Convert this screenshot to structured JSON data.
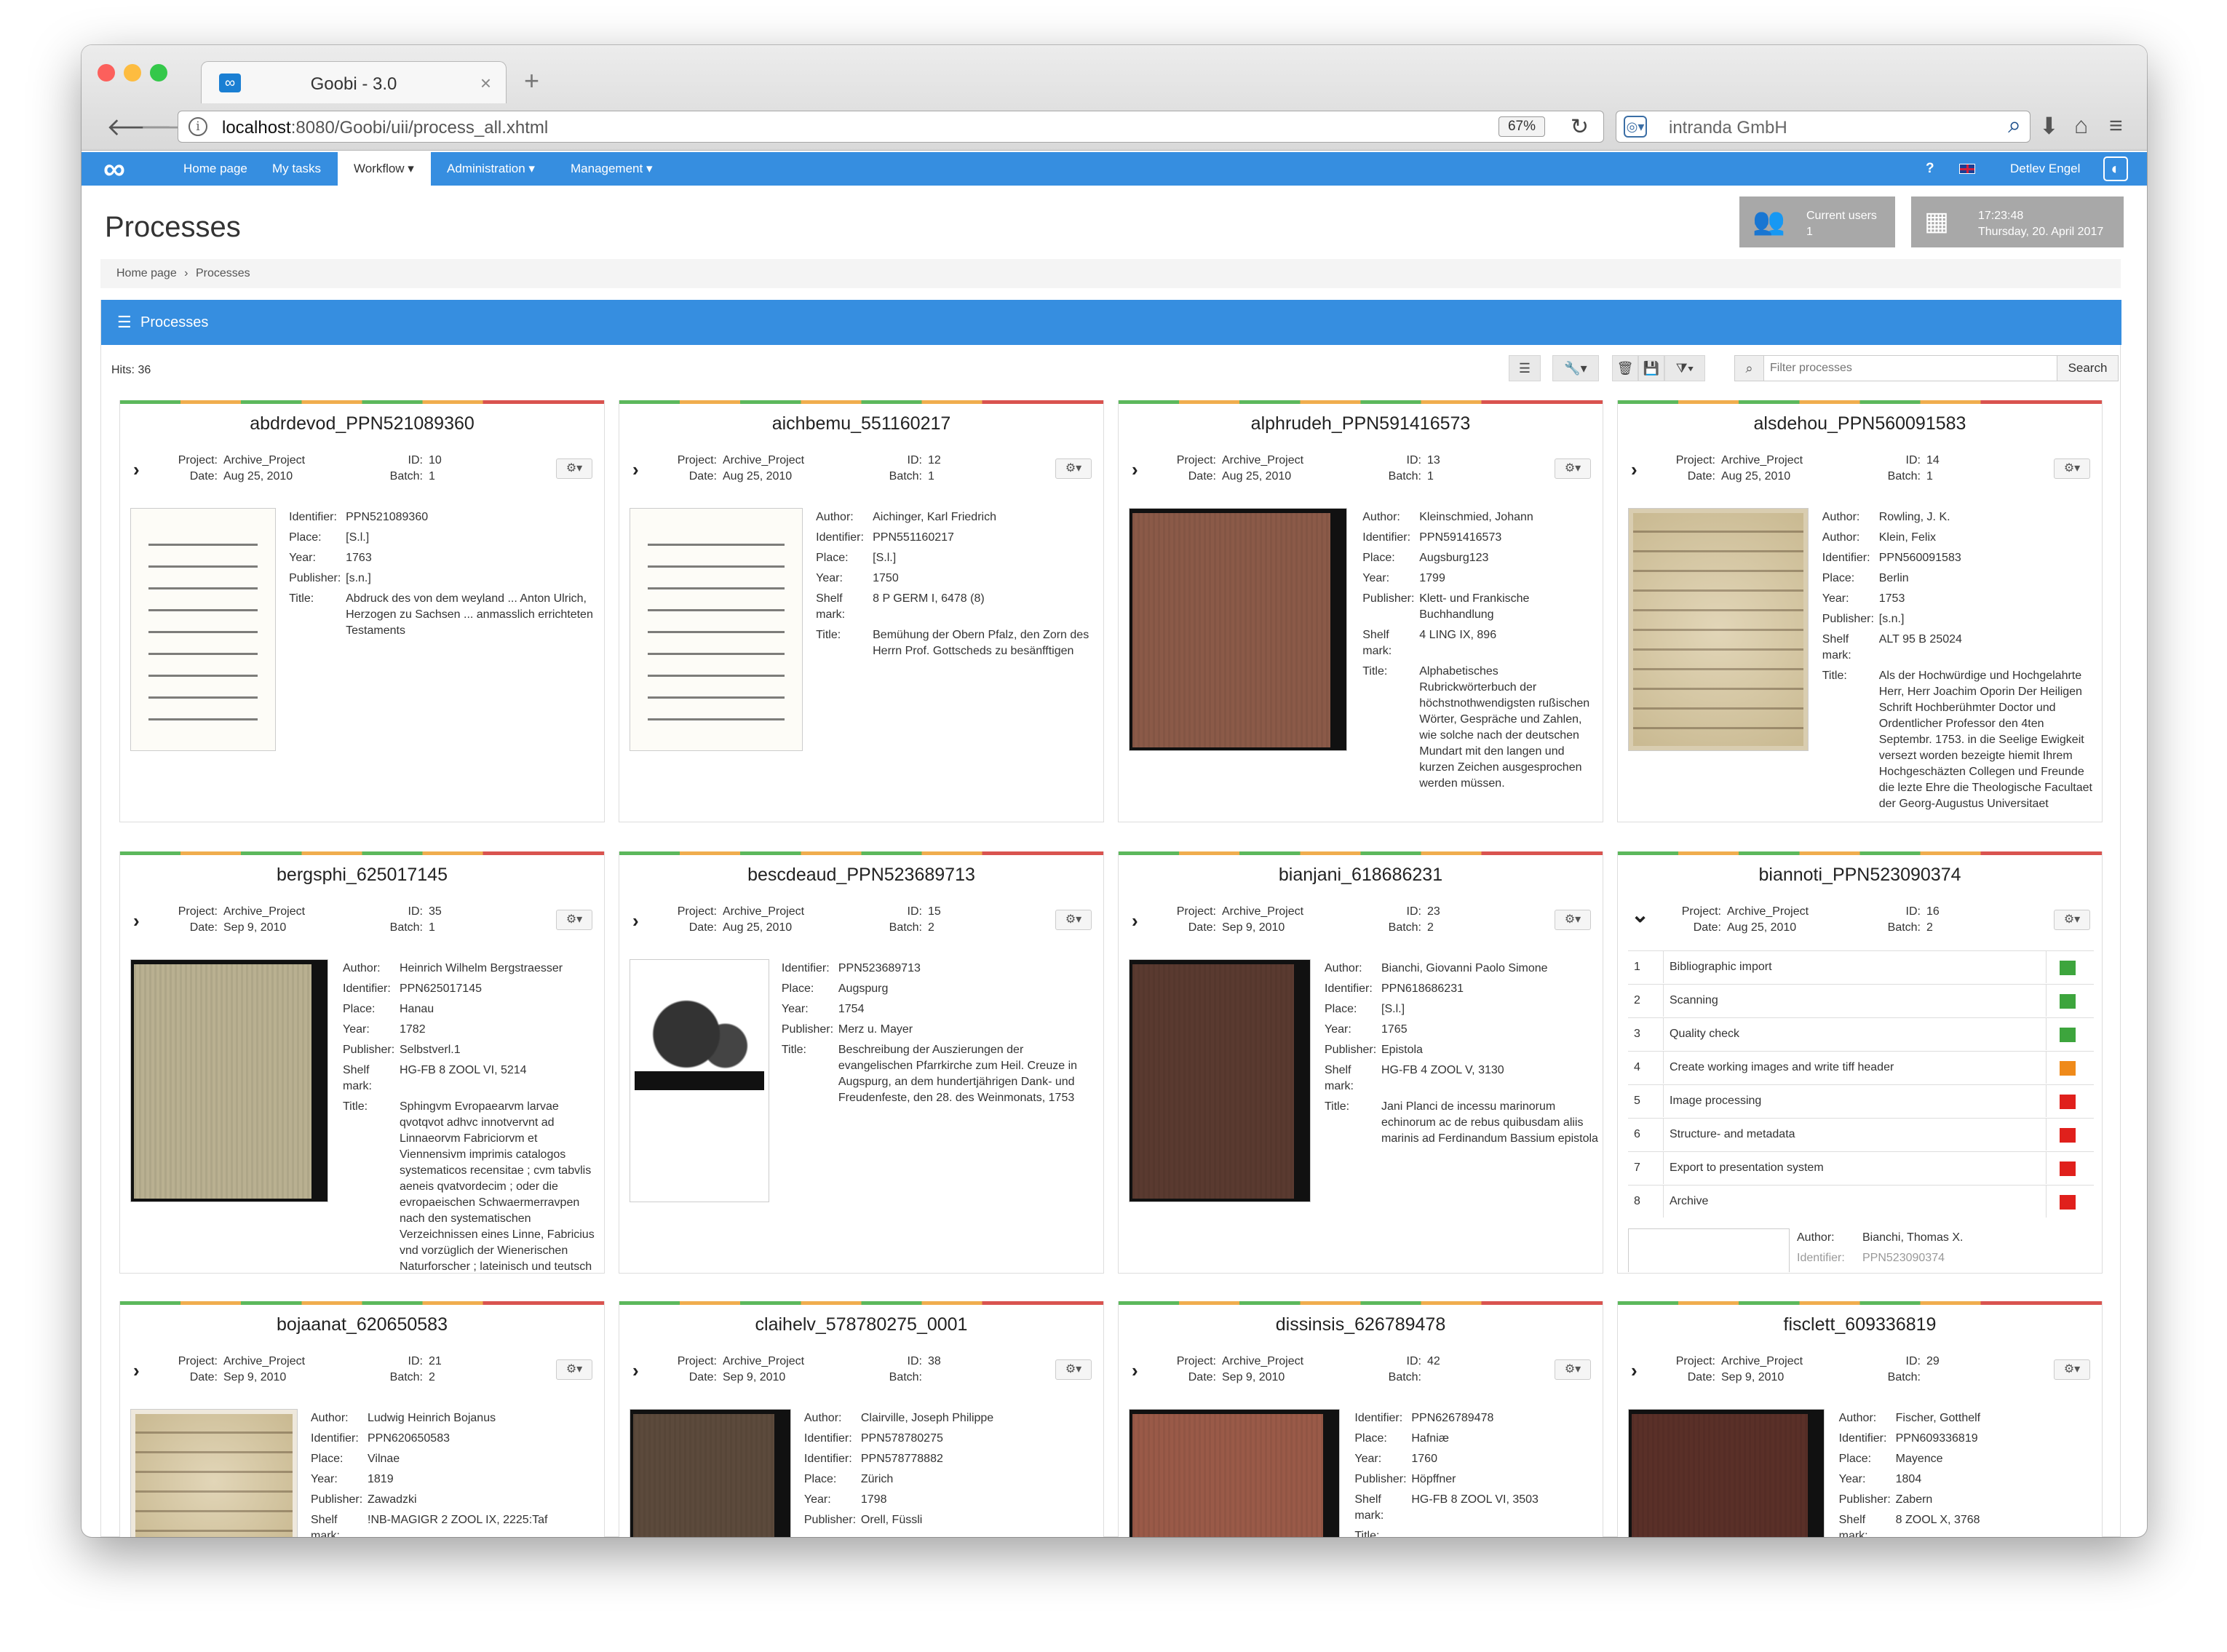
{
  "browser": {
    "tab_title": "Goobi - 3.0",
    "url_host": "localhost",
    "url_rest": ":8080/Goobi/uii/process_all.xhtml",
    "zoom": "67%",
    "search_placeholder": "intranda GmbH"
  },
  "nav": {
    "items": [
      "Home page",
      "My tasks",
      "Workflow ▾",
      "Administration ▾",
      "Management ▾"
    ],
    "help": "?",
    "user": "Detlev Engel"
  },
  "header": {
    "title": "Processes",
    "current_users_label": "Current users",
    "current_users_count": "1",
    "time": "17:23:48",
    "date": "Thursday, 20. April 2017"
  },
  "breadcrumb": {
    "home": "Home page",
    "sep": "›",
    "current": "Processes"
  },
  "panel": {
    "title": "Processes",
    "hits": "Hits: 36",
    "filter_placeholder": "Filter processes",
    "search_label": "Search"
  },
  "colors": {
    "accent": "#368ee0",
    "done": "#5cb85c",
    "working": "#f0ad4e",
    "open": "#d9534f"
  },
  "labels": {
    "project": "Project:",
    "date": "Date:",
    "id": "ID:",
    "batch": "Batch:"
  },
  "cards": [
    {
      "title": "abdrdevod_PPN521089360",
      "project": "Archive_Project",
      "date": "Aug 25, 2010",
      "id": "10",
      "batch": "1",
      "fields": [
        [
          "Identifier:",
          "PPN521089360"
        ],
        [
          "Place:",
          "[S.l.]"
        ],
        [
          "Year:",
          "1763"
        ],
        [
          "Publisher:",
          "[s.n.]"
        ],
        [
          "Title:",
          "Abdruck des von dem weyland ... Anton Ulrich, Herzogen zu Sachsen ... anmasslich errichteten Testaments"
        ]
      ]
    },
    {
      "title": "aichbemu_551160217",
      "project": "Archive_Project",
      "date": "Aug 25, 2010",
      "id": "12",
      "batch": "1",
      "fields": [
        [
          "Author:",
          "Aichinger, Karl Friedrich"
        ],
        [
          "Identifier:",
          "PPN551160217"
        ],
        [
          "Place:",
          "[S.l.]"
        ],
        [
          "Year:",
          "1750"
        ],
        [
          "Shelf mark:",
          "8 P GERM I, 6478 (8)"
        ],
        [
          "Title:",
          "Bemühung der Obern Pfalz, den Zorn des Herrn Prof. Gottscheds zu besänfftigen"
        ]
      ]
    },
    {
      "title": "alphrudeh_PPN591416573",
      "project": "Archive_Project",
      "date": "Aug 25, 2010",
      "id": "13",
      "batch": "1",
      "fields": [
        [
          "Author:",
          "Kleinschmied, Johann"
        ],
        [
          "Identifier:",
          "PPN591416573"
        ],
        [
          "Place:",
          "Augsburg123"
        ],
        [
          "Year:",
          "1799"
        ],
        [
          "Publisher:",
          "Klett- und Frankische Buchhandlung"
        ],
        [
          "Shelf mark:",
          "4 LING IX, 896"
        ],
        [
          "Title:",
          "Alphabetisches Rubrickwörterbuch der höchstnothwendigsten rußischen Wörter, Gespräche und Zahlen, wie solche nach der deutschen Mundart mit den langen und kurzen Zeichen ausgesprochen werden müssen."
        ]
      ]
    },
    {
      "title": "alsdehou_PPN560091583",
      "project": "Archive_Project",
      "date": "Aug 25, 2010",
      "id": "14",
      "batch": "1",
      "fields": [
        [
          "Author:",
          "Rowling, J. K."
        ],
        [
          "Author:",
          "Klein, Felix"
        ],
        [
          "Identifier:",
          "PPN560091583"
        ],
        [
          "Place:",
          "Berlin"
        ],
        [
          "Year:",
          "1753"
        ],
        [
          "Publisher:",
          "[s.n.]"
        ],
        [
          "Shelf mark:",
          "ALT 95 B 25024"
        ],
        [
          "Title:",
          "Als der Hochwürdige und Hochgelahrte Herr, Herr Joachim Oporin Der Heiligen Schrift Hochberühmter Doctor und Ordentlicher Professor den 4ten Septembr. 1753. in die Seelige Ewigkeit versezt worden bezeigte hiemit Ihrem Hochgeschäzten Collegen und Freunde die lezte Ehre die Theologische Facultaet der Georg-Augustus Universitaet"
        ]
      ]
    },
    {
      "title": "bergsphi_625017145",
      "project": "Archive_Project",
      "date": "Sep 9, 2010",
      "id": "35",
      "batch": "1",
      "fields": [
        [
          "Author:",
          "Heinrich Wilhelm Bergstraesser"
        ],
        [
          "Identifier:",
          "PPN625017145"
        ],
        [
          "Place:",
          "Hanau"
        ],
        [
          "Year:",
          "1782"
        ],
        [
          "Publisher:",
          "Selbstverl.1"
        ],
        [
          "Shelf mark:",
          "HG-FB 8 ZOOL VI, 5214"
        ],
        [
          "Title:",
          "Sphingvm Evropaearvm larvae qvotqvot adhvc innotvervnt ad Linnaeorvm Fabriciorvm et Viennensivm imprimis catalogos systematicos recensitae ; cvm tabvlis aeneis qvatvordecim ; oder die evropaeischen Schwaermerravpen nach den systematischen Verzeichnissen eines Linne, Fabricius vnd vorzüglich der Wienerischen Naturforscher ; lateinisch und teutsch"
        ]
      ]
    },
    {
      "title": "bescdeaud_PPN523689713",
      "project": "Archive_Project",
      "date": "Aug 25, 2010",
      "id": "15",
      "batch": "2",
      "fields": [
        [
          "Identifier:",
          "PPN523689713"
        ],
        [
          "Place:",
          "Augspurg"
        ],
        [
          "Year:",
          "1754"
        ],
        [
          "Publisher:",
          "Merz u. Mayer"
        ],
        [
          "Title:",
          "Beschreibung der Auszierungen der evangelischen Pfarrkirche zum Heil. Creuze in Augspurg, an dem hundertjährigen Dank- und Freudenfeste, den 28. des Weinmonats, 1753"
        ]
      ]
    },
    {
      "title": "bianjani_618686231",
      "project": "Archive_Project",
      "date": "Sep 9, 2010",
      "id": "23",
      "batch": "2",
      "fields": [
        [
          "Author:",
          "Bianchi, Giovanni Paolo Simone"
        ],
        [
          "Identifier:",
          "PPN618686231"
        ],
        [
          "Place:",
          "[S.l.]"
        ],
        [
          "Year:",
          "1765"
        ],
        [
          "Publisher:",
          "Epistola"
        ],
        [
          "Shelf mark:",
          "HG-FB 4 ZOOL V, 3130"
        ],
        [
          "Title:",
          "Jani Planci de incessu marinorum echinorum ac de rebus quibusdam aliis marinis ad Ferdinandum Bassium epistola"
        ]
      ]
    },
    {
      "title": "biannoti_PPN523090374",
      "project": "Archive_Project",
      "date": "Aug 25, 2010",
      "id": "16",
      "batch": "2",
      "tasks": [
        [
          "1",
          "Bibliographic import",
          "#3da53d"
        ],
        [
          "2",
          "Scanning",
          "#3da53d"
        ],
        [
          "3",
          "Quality check",
          "#3da53d"
        ],
        [
          "4",
          "Create working images and write tiff header",
          "#ef8a1a"
        ],
        [
          "5",
          "Image processing",
          "#e0201c"
        ],
        [
          "6",
          "Structure- and metadata",
          "#e0201c"
        ],
        [
          "7",
          "Export to presentation system",
          "#e0201c"
        ],
        [
          "8",
          "Archive",
          "#e0201c"
        ]
      ],
      "fields": [
        [
          "Author:",
          "Bianchi, Thomas X."
        ],
        [
          "Identifier:",
          "PPN523090374"
        ]
      ]
    },
    {
      "title": "bojaanat_620650583",
      "project": "Archive_Project",
      "date": "Sep 9, 2010",
      "id": "21",
      "batch": "2",
      "fields": [
        [
          "Author:",
          "Ludwig Heinrich Bojanus"
        ],
        [
          "Identifier:",
          "PPN620650583"
        ],
        [
          "Place:",
          "Vilnae"
        ],
        [
          "Year:",
          "1819"
        ],
        [
          "Publisher:",
          "Zawadzki"
        ],
        [
          "Shelf mark:",
          "!NB-MAGIGR 2 ZOOL IX, 2225:Taf"
        ]
      ]
    },
    {
      "title": "claihelv_578780275_0001",
      "project": "Archive_Project",
      "date": "Sep 9, 2010",
      "id": "38",
      "batch": "",
      "fields": [
        [
          "Author:",
          "Clairville, Joseph Philippe"
        ],
        [
          "Identifier:",
          "PPN578780275"
        ],
        [
          "Identifier:",
          "PPN578778882"
        ],
        [
          "Place:",
          "Zürich"
        ],
        [
          "Year:",
          "1798"
        ],
        [
          "Publisher:",
          "Orell, Füssli"
        ]
      ]
    },
    {
      "title": "dissinsis_626789478",
      "project": "Archive_Project",
      "date": "Sep 9, 2010",
      "id": "42",
      "batch": "",
      "fields": [
        [
          "Identifier:",
          "PPN626789478"
        ],
        [
          "Place:",
          "Hafniæ"
        ],
        [
          "Year:",
          "1760"
        ],
        [
          "Publisher:",
          "Höpffner"
        ],
        [
          "Shelf mark:",
          "HG-FB 8 ZOOL VI, 3503"
        ],
        [
          "Title:",
          ""
        ]
      ]
    },
    {
      "title": "fisclett_609336819",
      "project": "Archive_Project",
      "date": "Sep 9, 2010",
      "id": "29",
      "batch": "",
      "fields": [
        [
          "Author:",
          "Fischer, Gotthelf"
        ],
        [
          "Identifier:",
          "PPN609336819"
        ],
        [
          "Place:",
          "Mayence"
        ],
        [
          "Year:",
          "1804"
        ],
        [
          "Publisher:",
          "Zabern"
        ],
        [
          "Shelf mark:",
          "8 ZOOL X, 3768"
        ]
      ]
    }
  ]
}
